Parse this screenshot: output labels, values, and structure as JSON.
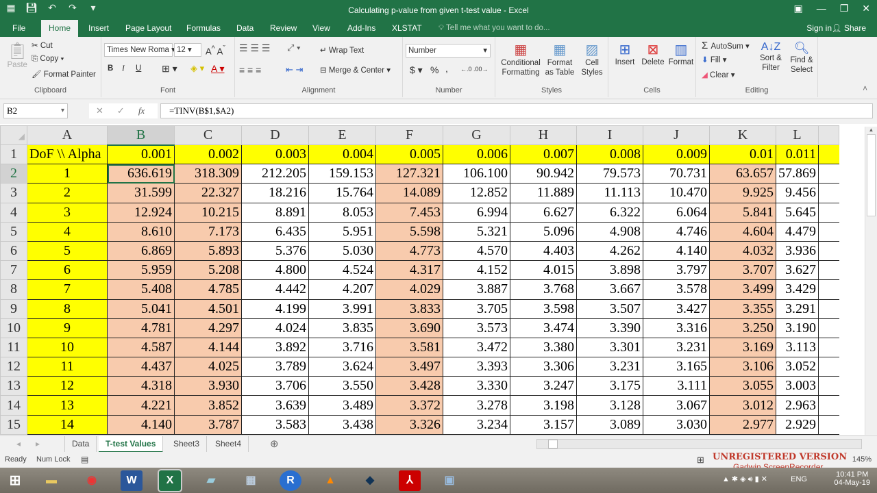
{
  "window": {
    "title": "Calculating p-value from given t-test value - Excel",
    "controls": [
      "ribbon-display",
      "minimize",
      "restore",
      "close"
    ]
  },
  "qat": [
    "save",
    "undo",
    "redo",
    "quick-access-menu"
  ],
  "tabs": [
    "File",
    "Home",
    "Insert",
    "Page Layout",
    "Formulas",
    "Data",
    "Review",
    "View",
    "Add-Ins",
    "XLSTAT"
  ],
  "active_tab": "Home",
  "tell_me": "Tell me what you want to do...",
  "sign_in": "Sign in",
  "share": "Share",
  "ribbon": {
    "clipboard": {
      "label": "Clipboard",
      "paste": "Paste",
      "cut": "Cut",
      "copy": "Copy",
      "format_painter": "Format Painter"
    },
    "font": {
      "label": "Font",
      "name": "Times New Roma",
      "size": "12",
      "bold": "B",
      "italic": "I",
      "underline": "U"
    },
    "alignment": {
      "label": "Alignment",
      "wrap": "Wrap Text",
      "merge": "Merge & Center"
    },
    "number": {
      "label": "Number",
      "format": "Number",
      "currency": "$",
      "percent": "%",
      "comma": ","
    },
    "styles": {
      "label": "Styles",
      "cond": "Conditional Formatting",
      "table": "Format as Table",
      "cell": "Cell Styles"
    },
    "cells": {
      "label": "Cells",
      "insert": "Insert",
      "delete": "Delete",
      "format": "Format"
    },
    "editing": {
      "label": "Editing",
      "autosum": "AutoSum",
      "fill": "Fill",
      "clear": "Clear",
      "sort": "Sort & Filter",
      "find": "Find & Select"
    }
  },
  "namebox": "B2",
  "formula": "=TINV(B$1,$A2)",
  "columns": [
    "A",
    "B",
    "C",
    "D",
    "E",
    "F",
    "G",
    "H",
    "I",
    "J",
    "K",
    "L"
  ],
  "header_row": [
    "DoF \\\\ Alpha",
    "0.001",
    "0.002",
    "0.003",
    "0.004",
    "0.005",
    "0.006",
    "0.007",
    "0.008",
    "0.009",
    "0.01",
    "0.011"
  ],
  "rows": [
    [
      "1",
      "636.619",
      "318.309",
      "212.205",
      "159.153",
      "127.321",
      "106.100",
      "90.942",
      "79.573",
      "70.731",
      "63.657",
      "57.869"
    ],
    [
      "2",
      "31.599",
      "22.327",
      "18.216",
      "15.764",
      "14.089",
      "12.852",
      "11.889",
      "11.113",
      "10.470",
      "9.925",
      "9.456"
    ],
    [
      "3",
      "12.924",
      "10.215",
      "8.891",
      "8.053",
      "7.453",
      "6.994",
      "6.627",
      "6.322",
      "6.064",
      "5.841",
      "5.645"
    ],
    [
      "4",
      "8.610",
      "7.173",
      "6.435",
      "5.951",
      "5.598",
      "5.321",
      "5.096",
      "4.908",
      "4.746",
      "4.604",
      "4.479"
    ],
    [
      "5",
      "6.869",
      "5.893",
      "5.376",
      "5.030",
      "4.773",
      "4.570",
      "4.403",
      "4.262",
      "4.140",
      "4.032",
      "3.936"
    ],
    [
      "6",
      "5.959",
      "5.208",
      "4.800",
      "4.524",
      "4.317",
      "4.152",
      "4.015",
      "3.898",
      "3.797",
      "3.707",
      "3.627"
    ],
    [
      "7",
      "5.408",
      "4.785",
      "4.442",
      "4.207",
      "4.029",
      "3.887",
      "3.768",
      "3.667",
      "3.578",
      "3.499",
      "3.429"
    ],
    [
      "8",
      "5.041",
      "4.501",
      "4.199",
      "3.991",
      "3.833",
      "3.705",
      "3.598",
      "3.507",
      "3.427",
      "3.355",
      "3.291"
    ],
    [
      "9",
      "4.781",
      "4.297",
      "4.024",
      "3.835",
      "3.690",
      "3.573",
      "3.474",
      "3.390",
      "3.316",
      "3.250",
      "3.190"
    ],
    [
      "10",
      "4.587",
      "4.144",
      "3.892",
      "3.716",
      "3.581",
      "3.472",
      "3.380",
      "3.301",
      "3.231",
      "3.169",
      "3.113"
    ],
    [
      "11",
      "4.437",
      "4.025",
      "3.789",
      "3.624",
      "3.497",
      "3.393",
      "3.306",
      "3.231",
      "3.165",
      "3.106",
      "3.052"
    ],
    [
      "12",
      "4.318",
      "3.930",
      "3.706",
      "3.550",
      "3.428",
      "3.330",
      "3.247",
      "3.175",
      "3.111",
      "3.055",
      "3.003"
    ],
    [
      "13",
      "4.221",
      "3.852",
      "3.639",
      "3.489",
      "3.372",
      "3.278",
      "3.198",
      "3.128",
      "3.067",
      "3.012",
      "2.963"
    ],
    [
      "14",
      "4.140",
      "3.787",
      "3.583",
      "3.438",
      "3.326",
      "3.234",
      "3.157",
      "3.089",
      "3.030",
      "2.977",
      "2.929"
    ]
  ],
  "highlight_columns": [
    "B",
    "C",
    "F",
    "K"
  ],
  "colors": {
    "header_fill": "#ffff00",
    "highlight_fill": "#f8cbad",
    "accent": "#217346"
  },
  "sheets": [
    "Data",
    "T-test Values",
    "Sheet3",
    "Sheet4"
  ],
  "active_sheet": "T-test Values",
  "status": {
    "ready": "Ready",
    "numlock": "Num Lock",
    "zoom": "145%"
  },
  "watermark": {
    "line1": "UNREGISTERED VERSION",
    "line2": "Gadwin ScreenRecorder"
  },
  "taskbar": {
    "apps": [
      "Start",
      "File Explorer",
      "Chrome",
      "Word",
      "Excel",
      "Notepad",
      "Calculator",
      "R",
      "VLC",
      "VirtualBox",
      "Acrobat",
      "Screen Recorder"
    ],
    "lang": "ENG",
    "time": "10:41 PM",
    "date": "04-May-19"
  }
}
